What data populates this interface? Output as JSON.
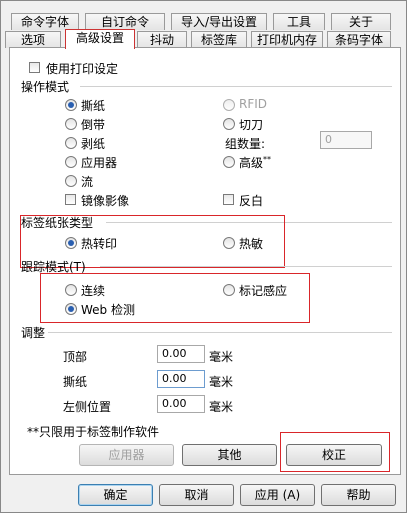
{
  "tabs_row1": [
    "命令字体",
    "自订命令",
    "导入/导出设置",
    "工具",
    "关于"
  ],
  "tabs_row2": [
    "选项",
    "高级设置",
    "抖动",
    "标签库",
    "打印机内存",
    "条码字体"
  ],
  "use_print_settings": {
    "label": "使用打印设定",
    "checked": false
  },
  "operation_mode": {
    "title": "操作模式",
    "tear": "撕纸",
    "rfid": "RFID",
    "rewind": "倒带",
    "cutter": "切刀",
    "peel": "剥纸",
    "group_count_label": "组数量:",
    "group_count_value": "0",
    "applicator": "应用器",
    "advanced": "高级",
    "advanced_marker": "**",
    "stream": "流",
    "mirror": "镜像影像",
    "reverse": "反白"
  },
  "label_stock": {
    "title": "标签纸张类型",
    "thermal_transfer": "热转印",
    "direct_thermal": "热敏"
  },
  "tracking_mode": {
    "title": "跟踪模式(T)",
    "continuous": "连续",
    "mark_sensing": "标记感应",
    "web_sensing": "Web 检测"
  },
  "adjust": {
    "title": "调整",
    "rows": [
      {
        "label": "顶部",
        "value": "0.00",
        "unit": "毫米"
      },
      {
        "label": "撕纸",
        "value": "0.00",
        "unit": "毫米"
      },
      {
        "label": "左侧位置",
        "value": "0.00",
        "unit": "毫米"
      }
    ]
  },
  "footnote": "**只限用于标签制作软件",
  "panel_buttons": {
    "applicator": "应用器",
    "other": "其他",
    "calibrate": "校正"
  },
  "dialog_buttons": {
    "ok": "确定",
    "cancel": "取消",
    "apply": "应用 (A)",
    "help": "帮助"
  }
}
